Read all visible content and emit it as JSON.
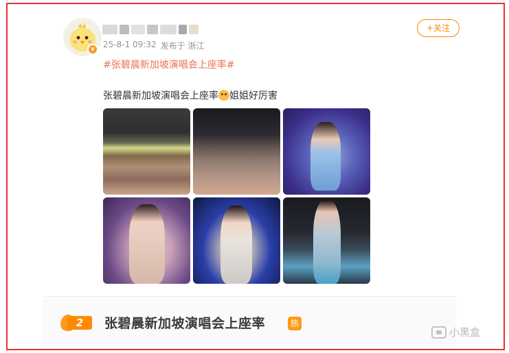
{
  "post": {
    "timestamp": "25-8-1 09:32",
    "location": "发布于 浙江",
    "follow_label": "+关注",
    "topic_tag": "#张碧晨新加坡演唱会上座率#",
    "text_before_emoji": "张碧晨新加坡演唱会上座率",
    "text_after_emoji": "姐姐好厉害",
    "emoji_icon": "surprised-face-icon",
    "verified_badge": "v"
  },
  "hot_search": {
    "rank": "2",
    "title": "张碧晨新加坡演唱会上座率",
    "badge": "热"
  },
  "watermark": {
    "text": "小黑盒"
  },
  "colors": {
    "border": "#e8302f",
    "accent_orange": "#ff8200",
    "topic": "#eb7350"
  }
}
